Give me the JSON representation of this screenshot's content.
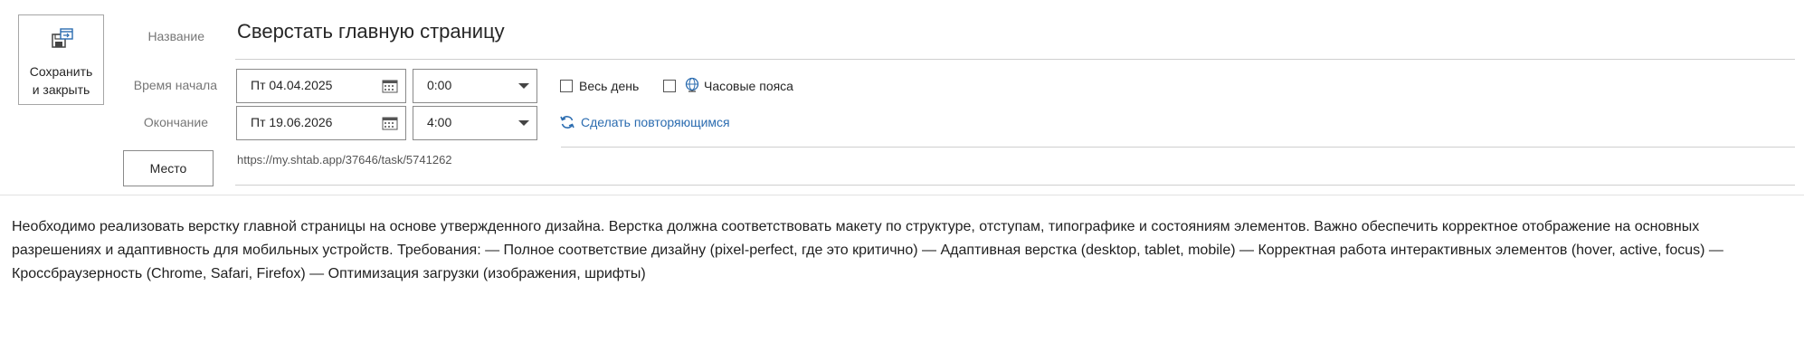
{
  "toolbar": {
    "save_close_label": "Сохранить\nи закрыть",
    "save_icon": "save-calendar-icon"
  },
  "form": {
    "title_label": "Название",
    "title_value": "Сверстать главную страницу",
    "start_label": "Время начала",
    "start_date": "Пт 04.04.2025",
    "start_time": "0:00",
    "end_label": "Окончание",
    "end_date": "Пт 19.06.2026",
    "end_time": "4:00",
    "all_day_label": "Весь день",
    "all_day_checked": false,
    "timezones_label": "Часовые пояса",
    "timezones_checked": false,
    "timezones_icon": "globe-icon",
    "repeat_label": "Сделать повторяющимся",
    "repeat_icon": "refresh-icon",
    "location_button_label": "Место",
    "location_value": "https://my.shtab.app/37646/task/5741262"
  },
  "description": "Необходимо реализовать верстку главной страницы на основе утвержденного дизайна. Верстка должна соответствовать макету по структуре, отступам, типографике и состояниям элементов. Важно обеспечить корректное отображение на основных разрешениях и адаптивность для мобильных устройств. Требования: — Полное соответствие дизайну (pixel-perfect, где это критично) — Адаптивная верстка (desktop, tablet, mobile) — Корректная работа интерактивных элементов (hover, active, focus) — Кроссбраузерность (Chrome, Safari, Firefox) — Оптимизация загрузки (изображения, шрифты)",
  "colors": {
    "link": "#2b6cb0",
    "border": "#8a8a8a",
    "label": "#767676"
  }
}
